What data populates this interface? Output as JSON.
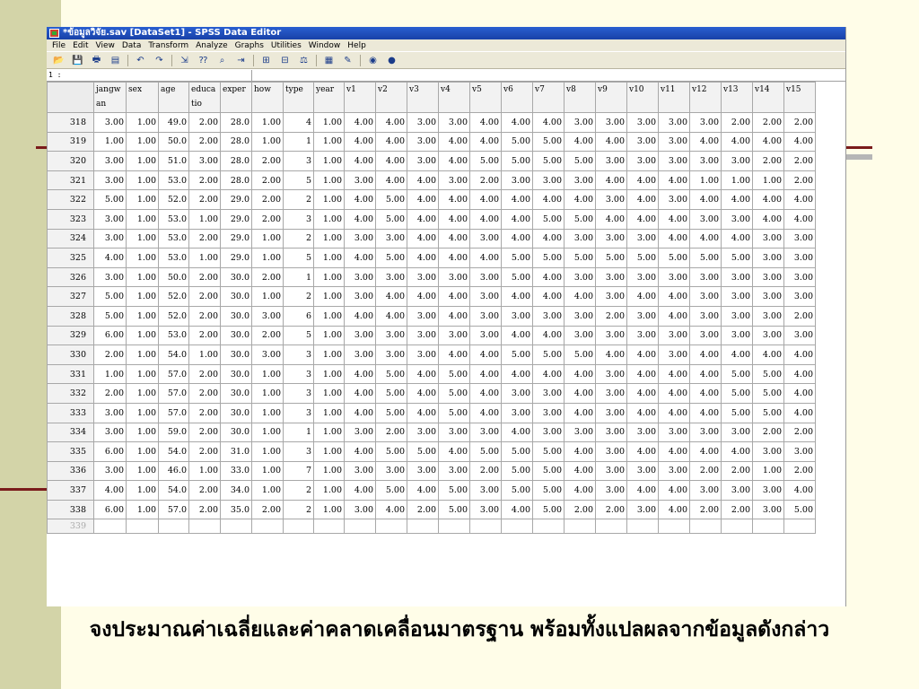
{
  "window": {
    "title": "*ข้อมูลวิจัย.sav [DataSet1] - SPSS Data Editor"
  },
  "menu": [
    "File",
    "Edit",
    "View",
    "Data",
    "Transform",
    "Analyze",
    "Graphs",
    "Utilities",
    "Window",
    "Help"
  ],
  "toolbar_icons": [
    {
      "name": "open-icon",
      "glyph": "📂"
    },
    {
      "name": "save-icon",
      "glyph": "💾"
    },
    {
      "name": "print-icon",
      "glyph": "🖶"
    },
    {
      "name": "dialog-recall-icon",
      "glyph": "▤"
    },
    {
      "name": "undo-icon",
      "glyph": "↶"
    },
    {
      "name": "redo-icon",
      "glyph": "↷"
    },
    {
      "name": "goto-case-icon",
      "glyph": "⇲"
    },
    {
      "name": "variables-icon",
      "glyph": "⁇"
    },
    {
      "name": "find-icon",
      "glyph": "⌕"
    },
    {
      "name": "insert-cases-icon",
      "glyph": "⇥"
    },
    {
      "name": "insert-variable-icon",
      "glyph": "⊞"
    },
    {
      "name": "split-file-icon",
      "glyph": "⊟"
    },
    {
      "name": "weight-cases-icon",
      "glyph": "⚖"
    },
    {
      "name": "select-cases-icon",
      "glyph": "▦"
    },
    {
      "name": "value-labels-icon",
      "glyph": "✎"
    },
    {
      "name": "use-sets-icon",
      "glyph": "◉"
    },
    {
      "name": "show-all-icon",
      "glyph": "●"
    }
  ],
  "cell_ref": "1 :",
  "columns": [
    "jangwan",
    "sex",
    "age",
    "educatio",
    "exper",
    "how",
    "type",
    "year",
    "v1",
    "v2",
    "v3",
    "v4",
    "v5",
    "v6",
    "v7",
    "v8",
    "v9",
    "v10",
    "v11",
    "v12",
    "v13",
    "v14",
    "v15"
  ],
  "rows": [
    {
      "n": "318",
      "cells": [
        "3.00",
        "1.00",
        "49.0",
        "2.00",
        "28.0",
        "1.00",
        "4",
        "1.00",
        "4.00",
        "4.00",
        "3.00",
        "3.00",
        "4.00",
        "4.00",
        "4.00",
        "3.00",
        "3.00",
        "3.00",
        "3.00",
        "3.00",
        "2.00",
        "2.00",
        "2.00"
      ]
    },
    {
      "n": "319",
      "cells": [
        "1.00",
        "1.00",
        "50.0",
        "2.00",
        "28.0",
        "1.00",
        "1",
        "1.00",
        "4.00",
        "4.00",
        "3.00",
        "4.00",
        "4.00",
        "5.00",
        "5.00",
        "4.00",
        "4.00",
        "3.00",
        "3.00",
        "4.00",
        "4.00",
        "4.00",
        "4.00"
      ]
    },
    {
      "n": "320",
      "cells": [
        "3.00",
        "1.00",
        "51.0",
        "3.00",
        "28.0",
        "2.00",
        "3",
        "1.00",
        "4.00",
        "4.00",
        "3.00",
        "4.00",
        "5.00",
        "5.00",
        "5.00",
        "5.00",
        "3.00",
        "3.00",
        "3.00",
        "3.00",
        "3.00",
        "2.00",
        "2.00"
      ]
    },
    {
      "n": "321",
      "cells": [
        "3.00",
        "1.00",
        "53.0",
        "2.00",
        "28.0",
        "2.00",
        "5",
        "1.00",
        "3.00",
        "4.00",
        "4.00",
        "3.00",
        "2.00",
        "3.00",
        "3.00",
        "3.00",
        "4.00",
        "4.00",
        "4.00",
        "1.00",
        "1.00",
        "1.00",
        "2.00"
      ]
    },
    {
      "n": "322",
      "cells": [
        "5.00",
        "1.00",
        "52.0",
        "2.00",
        "29.0",
        "2.00",
        "2",
        "1.00",
        "4.00",
        "5.00",
        "4.00",
        "4.00",
        "4.00",
        "4.00",
        "4.00",
        "4.00",
        "3.00",
        "4.00",
        "3.00",
        "4.00",
        "4.00",
        "4.00",
        "4.00"
      ]
    },
    {
      "n": "323",
      "cells": [
        "3.00",
        "1.00",
        "53.0",
        "1.00",
        "29.0",
        "2.00",
        "3",
        "1.00",
        "4.00",
        "5.00",
        "4.00",
        "4.00",
        "4.00",
        "4.00",
        "5.00",
        "5.00",
        "4.00",
        "4.00",
        "4.00",
        "3.00",
        "3.00",
        "4.00",
        "4.00"
      ]
    },
    {
      "n": "324",
      "cells": [
        "3.00",
        "1.00",
        "53.0",
        "2.00",
        "29.0",
        "1.00",
        "2",
        "1.00",
        "3.00",
        "3.00",
        "4.00",
        "4.00",
        "3.00",
        "4.00",
        "4.00",
        "3.00",
        "3.00",
        "3.00",
        "4.00",
        "4.00",
        "4.00",
        "3.00",
        "3.00"
      ]
    },
    {
      "n": "325",
      "cells": [
        "4.00",
        "1.00",
        "53.0",
        "1.00",
        "29.0",
        "1.00",
        "5",
        "1.00",
        "4.00",
        "5.00",
        "4.00",
        "4.00",
        "4.00",
        "5.00",
        "5.00",
        "5.00",
        "5.00",
        "5.00",
        "5.00",
        "5.00",
        "5.00",
        "3.00",
        "3.00"
      ]
    },
    {
      "n": "326",
      "cells": [
        "3.00",
        "1.00",
        "50.0",
        "2.00",
        "30.0",
        "2.00",
        "1",
        "1.00",
        "3.00",
        "3.00",
        "3.00",
        "3.00",
        "3.00",
        "5.00",
        "4.00",
        "3.00",
        "3.00",
        "3.00",
        "3.00",
        "3.00",
        "3.00",
        "3.00",
        "3.00"
      ]
    },
    {
      "n": "327",
      "cells": [
        "5.00",
        "1.00",
        "52.0",
        "2.00",
        "30.0",
        "1.00",
        "2",
        "1.00",
        "3.00",
        "4.00",
        "4.00",
        "4.00",
        "3.00",
        "4.00",
        "4.00",
        "4.00",
        "3.00",
        "4.00",
        "4.00",
        "3.00",
        "3.00",
        "3.00",
        "3.00"
      ]
    },
    {
      "n": "328",
      "cells": [
        "5.00",
        "1.00",
        "52.0",
        "2.00",
        "30.0",
        "3.00",
        "6",
        "1.00",
        "4.00",
        "4.00",
        "3.00",
        "4.00",
        "3.00",
        "3.00",
        "3.00",
        "3.00",
        "2.00",
        "3.00",
        "4.00",
        "3.00",
        "3.00",
        "3.00",
        "2.00"
      ]
    },
    {
      "n": "329",
      "cells": [
        "6.00",
        "1.00",
        "53.0",
        "2.00",
        "30.0",
        "2.00",
        "5",
        "1.00",
        "3.00",
        "3.00",
        "3.00",
        "3.00",
        "3.00",
        "4.00",
        "4.00",
        "3.00",
        "3.00",
        "3.00",
        "3.00",
        "3.00",
        "3.00",
        "3.00",
        "3.00"
      ]
    },
    {
      "n": "330",
      "cells": [
        "2.00",
        "1.00",
        "54.0",
        "1.00",
        "30.0",
        "3.00",
        "3",
        "1.00",
        "3.00",
        "3.00",
        "3.00",
        "4.00",
        "4.00",
        "5.00",
        "5.00",
        "5.00",
        "4.00",
        "4.00",
        "3.00",
        "4.00",
        "4.00",
        "4.00",
        "4.00"
      ]
    },
    {
      "n": "331",
      "cells": [
        "1.00",
        "1.00",
        "57.0",
        "2.00",
        "30.0",
        "1.00",
        "3",
        "1.00",
        "4.00",
        "5.00",
        "4.00",
        "5.00",
        "4.00",
        "4.00",
        "4.00",
        "4.00",
        "3.00",
        "4.00",
        "4.00",
        "4.00",
        "5.00",
        "5.00",
        "4.00"
      ]
    },
    {
      "n": "332",
      "cells": [
        "2.00",
        "1.00",
        "57.0",
        "2.00",
        "30.0",
        "1.00",
        "3",
        "1.00",
        "4.00",
        "5.00",
        "4.00",
        "5.00",
        "4.00",
        "3.00",
        "3.00",
        "4.00",
        "3.00",
        "4.00",
        "4.00",
        "4.00",
        "5.00",
        "5.00",
        "4.00"
      ]
    },
    {
      "n": "333",
      "cells": [
        "3.00",
        "1.00",
        "57.0",
        "2.00",
        "30.0",
        "1.00",
        "3",
        "1.00",
        "4.00",
        "5.00",
        "4.00",
        "5.00",
        "4.00",
        "3.00",
        "3.00",
        "4.00",
        "3.00",
        "4.00",
        "4.00",
        "4.00",
        "5.00",
        "5.00",
        "4.00"
      ]
    },
    {
      "n": "334",
      "cells": [
        "3.00",
        "1.00",
        "59.0",
        "2.00",
        "30.0",
        "1.00",
        "1",
        "1.00",
        "3.00",
        "2.00",
        "3.00",
        "3.00",
        "3.00",
        "4.00",
        "3.00",
        "3.00",
        "3.00",
        "3.00",
        "3.00",
        "3.00",
        "3.00",
        "2.00",
        "2.00"
      ]
    },
    {
      "n": "335",
      "cells": [
        "6.00",
        "1.00",
        "54.0",
        "2.00",
        "31.0",
        "1.00",
        "3",
        "1.00",
        "4.00",
        "5.00",
        "5.00",
        "4.00",
        "5.00",
        "5.00",
        "5.00",
        "4.00",
        "3.00",
        "4.00",
        "4.00",
        "4.00",
        "4.00",
        "3.00",
        "3.00"
      ]
    },
    {
      "n": "336",
      "cells": [
        "3.00",
        "1.00",
        "46.0",
        "1.00",
        "33.0",
        "1.00",
        "7",
        "1.00",
        "3.00",
        "3.00",
        "3.00",
        "3.00",
        "2.00",
        "5.00",
        "5.00",
        "4.00",
        "3.00",
        "3.00",
        "3.00",
        "2.00",
        "2.00",
        "1.00",
        "2.00"
      ]
    },
    {
      "n": "337",
      "cells": [
        "4.00",
        "1.00",
        "54.0",
        "2.00",
        "34.0",
        "1.00",
        "2",
        "1.00",
        "4.00",
        "5.00",
        "4.00",
        "5.00",
        "3.00",
        "5.00",
        "5.00",
        "4.00",
        "3.00",
        "4.00",
        "4.00",
        "3.00",
        "3.00",
        "3.00",
        "4.00"
      ]
    },
    {
      "n": "338",
      "cells": [
        "6.00",
        "1.00",
        "57.0",
        "2.00",
        "35.0",
        "2.00",
        "2",
        "1.00",
        "3.00",
        "4.00",
        "2.00",
        "5.00",
        "3.00",
        "4.00",
        "5.00",
        "2.00",
        "2.00",
        "3.00",
        "4.00",
        "2.00",
        "2.00",
        "3.00",
        "5.00"
      ]
    }
  ],
  "empty_row": "339",
  "caption": "จงประมาณค่าเฉลี่ยและค่าคลาดเคลื่อนมาตรฐาน พร้อมทั้งแปลผลจากข้อมูลดังกล่าว"
}
